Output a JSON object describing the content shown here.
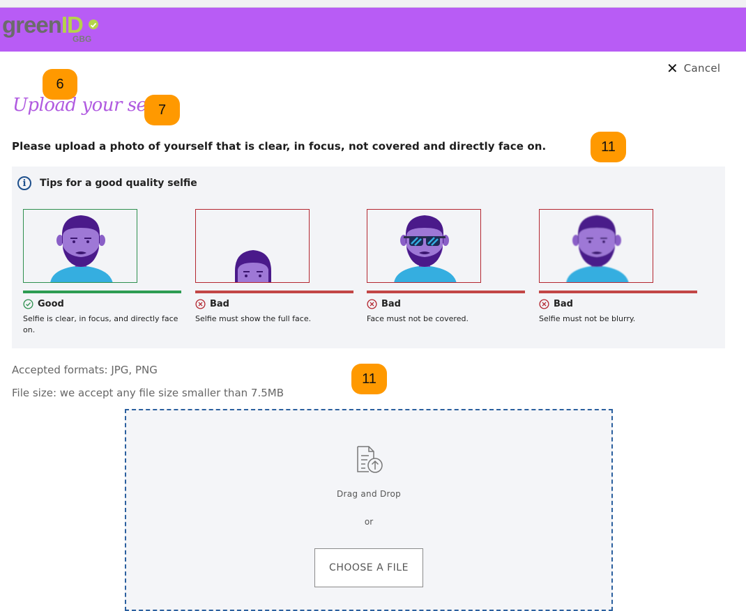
{
  "header": {
    "logo": {
      "brand_main": "green",
      "brand_id": "ID",
      "brand_sub": "GBG",
      "icon": "check-circle-icon"
    },
    "background_color": "#b85cf5"
  },
  "cancel": {
    "icon": "close-icon",
    "label": "Cancel"
  },
  "annotations": [
    "6",
    "7",
    "11",
    "11"
  ],
  "page": {
    "title": "Upload your selfie",
    "intro": "Please upload a photo of yourself that is clear, in focus, not covered and directly face on."
  },
  "tips": {
    "icon": "info-icon",
    "title": "Tips for a good quality selfie",
    "cards": [
      {
        "status": "Good",
        "status_icon": "check-circle-icon",
        "description": "Selfie is clear, in focus, and directly face on.",
        "status_color": "#2d9c52"
      },
      {
        "status": "Bad",
        "status_icon": "x-circle-icon",
        "description": "Selfie must show the full face.",
        "status_color": "#c24646"
      },
      {
        "status": "Bad",
        "status_icon": "x-circle-icon",
        "description": "Face must not be covered.",
        "status_color": "#c24646"
      },
      {
        "status": "Bad",
        "status_icon": "x-circle-icon",
        "description": "Selfie must not be blurry.",
        "status_color": "#c24646"
      }
    ]
  },
  "upload": {
    "accepted_formats": "Accepted formats: JPG, PNG",
    "file_size": "File size: we accept any file size smaller than 7.5MB",
    "dropzone": {
      "icon": "file-upload-icon",
      "drag_text": "Drag and Drop",
      "or_text": "or",
      "button_label": "CHOOSE A FILE"
    }
  },
  "colors": {
    "accent": "#b85cf5",
    "title": "#b05ae0",
    "badge": "#ff9900",
    "link": "#2a5f9e"
  }
}
